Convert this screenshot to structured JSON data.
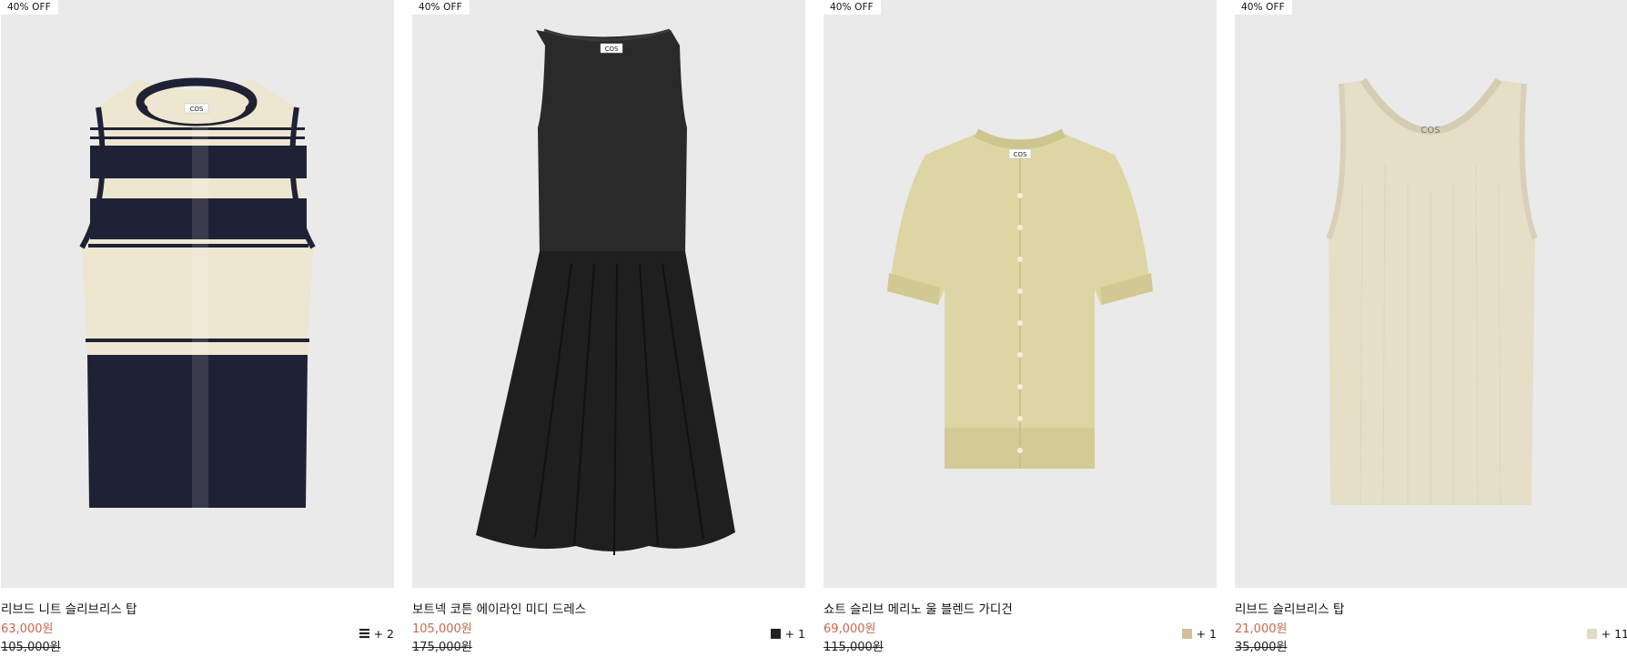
{
  "products": [
    {
      "badge": "40% OFF",
      "name": "리브드 니트 슬리브리스 탑",
      "sale_price": "63,000원",
      "original_price": "105,000원",
      "more_colors": "+ 2",
      "swatch_color": "#1f2233"
    },
    {
      "badge": "40% OFF",
      "name": "보트넥 코튼 에이라인 미디 드레스",
      "sale_price": "105,000원",
      "original_price": "175,000원",
      "more_colors": "+ 1",
      "swatch_color": "#222222"
    },
    {
      "badge": "40% OFF",
      "name": "쇼트 슬리브 메리노 울 블렌드 가디건",
      "sale_price": "69,000원",
      "original_price": "115,000원",
      "more_colors": "+ 1",
      "swatch_color": "#cfc09a"
    },
    {
      "badge": "40% OFF",
      "name": "리브드 슬리브리스 탑",
      "sale_price": "21,000원",
      "original_price": "35,000원",
      "more_colors": "+ 11",
      "swatch_color": "#e3dac6"
    }
  ],
  "colors": {
    "sale_price": "#c8684a",
    "background": "#ffffff"
  }
}
